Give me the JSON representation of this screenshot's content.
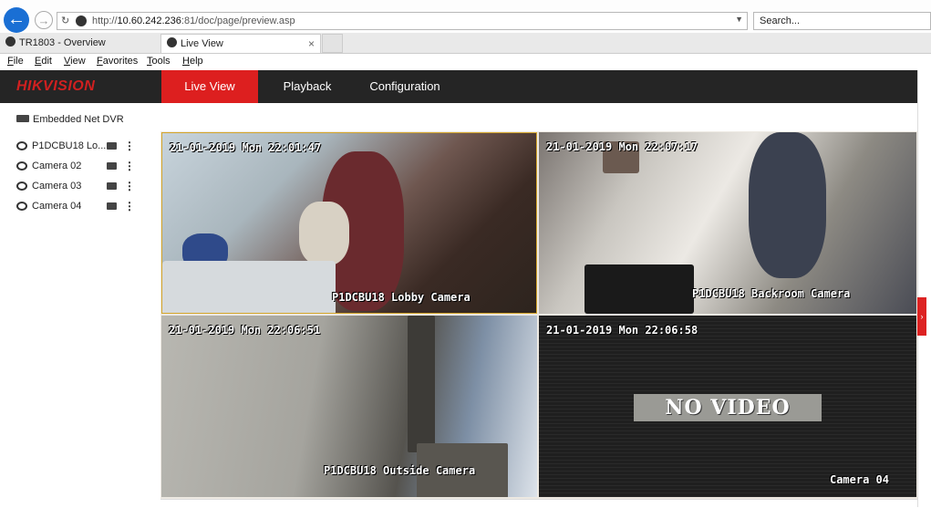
{
  "browser": {
    "url_prefix": "http://",
    "url_host": "10.60.242.236",
    "url_rest": ":81/doc/page/preview.asp",
    "search_placeholder": "Search...",
    "tabs": [
      {
        "label": "TR1803 - Overview"
      },
      {
        "label": "Live View",
        "close": "×"
      }
    ],
    "menu": [
      "File",
      "Edit",
      "View",
      "Favorites",
      "Tools",
      "Help"
    ]
  },
  "app": {
    "logo": "HIKVISION",
    "nav": [
      {
        "label": "Live View",
        "active": true
      },
      {
        "label": "Playback"
      },
      {
        "label": "Configuration"
      }
    ],
    "accent_color": "#dd1f1f"
  },
  "sidebar": {
    "device": "Embedded Net DVR",
    "cameras": [
      {
        "label": "P1DCBU18 Lo..."
      },
      {
        "label": "Camera 02"
      },
      {
        "label": "Camera 03"
      },
      {
        "label": "Camera 04"
      }
    ]
  },
  "video": {
    "tiles": [
      {
        "timestamp": "21-01-2019 Mon 22:01:47",
        "name": "P1DCBU18 Lobby Camera",
        "selected": true
      },
      {
        "timestamp": "21-01-2019 Mon 22:07:17",
        "name": "P1DCBU18 Backroom Camera"
      },
      {
        "timestamp": "21-01-2019 Mon 22:06:51",
        "name": "P1DCBU18 Outside Camera"
      },
      {
        "timestamp": "21-01-2019 Mon 22:06:58",
        "name": "Camera 04",
        "status": "NO VIDEO"
      }
    ]
  }
}
